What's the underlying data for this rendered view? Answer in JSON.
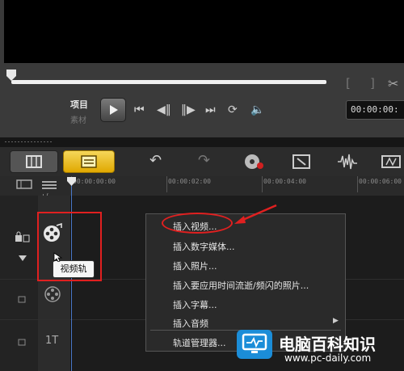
{
  "preview": {
    "mode_project": "项目",
    "mode_clip": "素材",
    "timecode": "00:00:00:"
  },
  "timeline": {
    "zoom_label": "+/−",
    "ruler_ticks": [
      "00:00:00:00",
      "00:00:02:00",
      "00:00:04:00",
      "00:00:06:00"
    ],
    "video_track_tooltip": "视频轨",
    "title_track_icon": "1T"
  },
  "context_menu": {
    "items": [
      "插入视频...",
      "插入数字媒体...",
      "插入照片...",
      "插入要应用时间流逝/频闪的照片...",
      "插入字幕...",
      "插入音频",
      "轨道管理器..."
    ]
  },
  "watermark": {
    "title": "电脑百科知识",
    "url": "www.pc-daily.com"
  },
  "colors": {
    "accent_yellow": "#f0c030",
    "annotation_red": "#e02020",
    "playhead_blue": "#4a78c8",
    "watermark_blue": "#1b8dd8"
  }
}
